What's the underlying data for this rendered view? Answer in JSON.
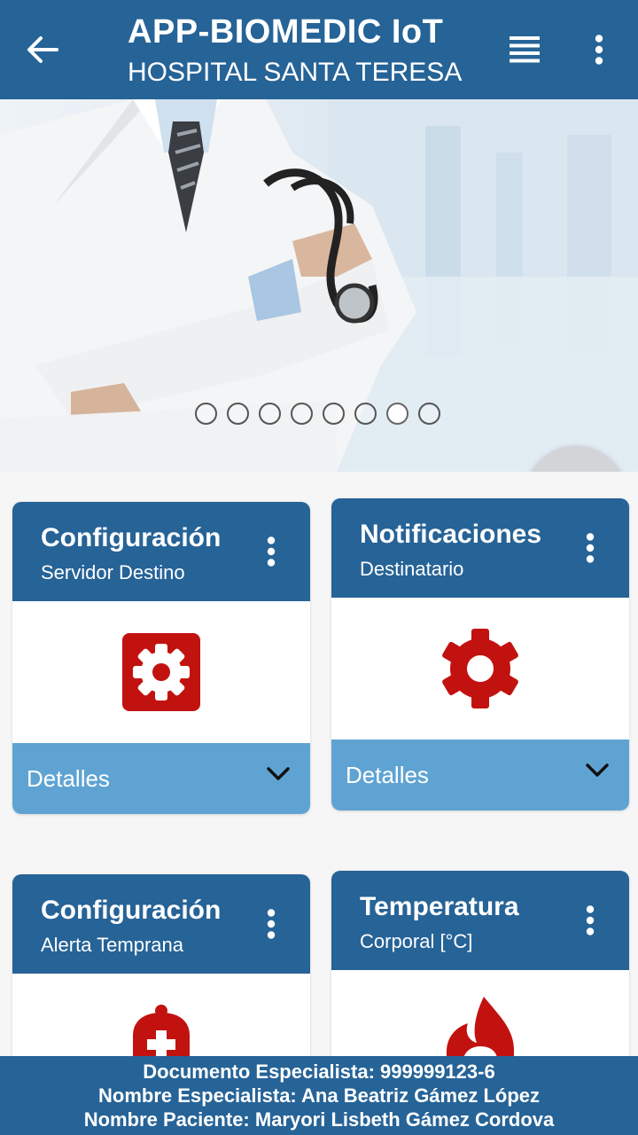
{
  "appbar": {
    "title": "APP-BIOMEDIC IoT",
    "subtitle": "HOSPITAL SANTA TERESA",
    "icons": [
      "arrow-back-icon",
      "list-icon",
      "more-vert-icon"
    ]
  },
  "carousel": {
    "slide_count": 8,
    "active_index": 6,
    "fab_icon": "bluetooth-searching-icon"
  },
  "cards": [
    {
      "title": "Configuración",
      "subtitle": "Servidor Destino",
      "icon": "settings-box-icon",
      "details": "Detalles"
    },
    {
      "title": "Notificaciones",
      "subtitle": "Destinatario",
      "icon": "settings-gear-icon",
      "details": "Detalles"
    },
    {
      "title": "Configuración",
      "subtitle": "Alerta Temprana",
      "icon": "medical-alert-icon"
    },
    {
      "title": "Temperatura",
      "subtitle": "Corporal [°C]",
      "icon": "flame-icon"
    }
  ],
  "footer": {
    "documento": "Documento Especialista: 999999123-6",
    "especialista": "Nombre Especialista: Ana Beatriz Gámez López",
    "paciente": "Nombre Paciente: Maryori Lisbeth Gámez Cordova"
  },
  "colors": {
    "primary": "#266397",
    "details_bar": "#5fa3d3",
    "icon_red": "#c2120f",
    "bluetooth": "#2f7cd6"
  }
}
